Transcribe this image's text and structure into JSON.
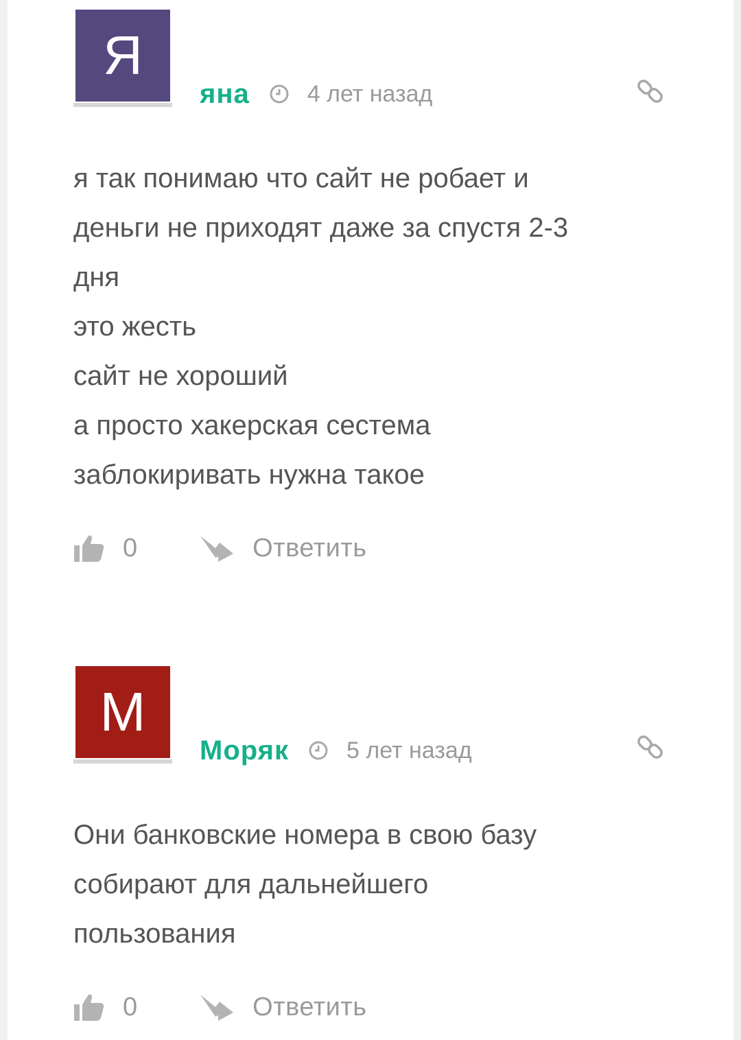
{
  "comments": [
    {
      "avatar_letter": "Я",
      "avatar_color": "#54487f",
      "author": "яна",
      "time": "4 лет назад",
      "clock_icon": "clock-icon",
      "link_icon": "link-icon",
      "lines": [
        "я так понимаю что сайт не робает и",
        "деньги не приходят даже за спустя 2-3",
        "дня",
        "это жесть",
        "сайт не хороший",
        "а просто хакерская сестема",
        "заблокиривать нужна такое"
      ],
      "likes": "0",
      "reply_label": "Ответить"
    },
    {
      "avatar_letter": "М",
      "avatar_color": "#a11d16",
      "author": "Моряк",
      "time": "5 лет назад",
      "clock_icon": "clock-icon",
      "link_icon": "link-icon",
      "lines": [
        "Они банковские номера в свою базу",
        "собирают для дальнейшего",
        "пользования"
      ],
      "likes": "0",
      "reply_label": "Ответить"
    }
  ],
  "colors": {
    "author": "#16b08a",
    "meta": "#9a9a9a",
    "body": "#555555",
    "icon": "#b3b3b3"
  }
}
